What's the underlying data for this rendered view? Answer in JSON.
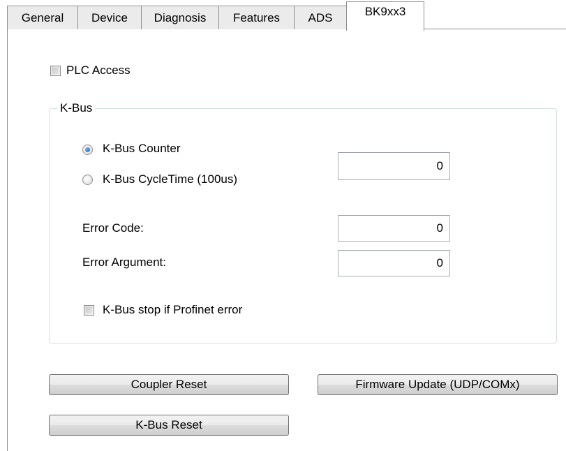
{
  "tabs": [
    {
      "label": "General",
      "active": false
    },
    {
      "label": "Device",
      "active": false
    },
    {
      "label": "Diagnosis",
      "active": false
    },
    {
      "label": "Features",
      "active": false
    },
    {
      "label": "ADS",
      "active": false
    },
    {
      "label": "BK9xx3",
      "active": true
    }
  ],
  "plc_access": {
    "label": "PLC Access",
    "checked": false
  },
  "kbus_group": {
    "title": "K-Bus",
    "radio_counter": {
      "label": "K-Bus Counter",
      "checked": true
    },
    "radio_cycletime": {
      "label": "K-Bus CycleTime (100us)",
      "checked": false
    },
    "counter_value": "0",
    "error_code": {
      "label": "Error Code:",
      "value": "0"
    },
    "error_argument": {
      "label": "Error Argument:",
      "value": "0"
    },
    "stop_on_error": {
      "label": "K-Bus stop if Profinet error",
      "checked": false
    }
  },
  "buttons": {
    "coupler_reset": "Coupler Reset",
    "firmware_update": "Firmware Update (UDP/COMx)",
    "kbus_reset": "K-Bus Reset"
  }
}
